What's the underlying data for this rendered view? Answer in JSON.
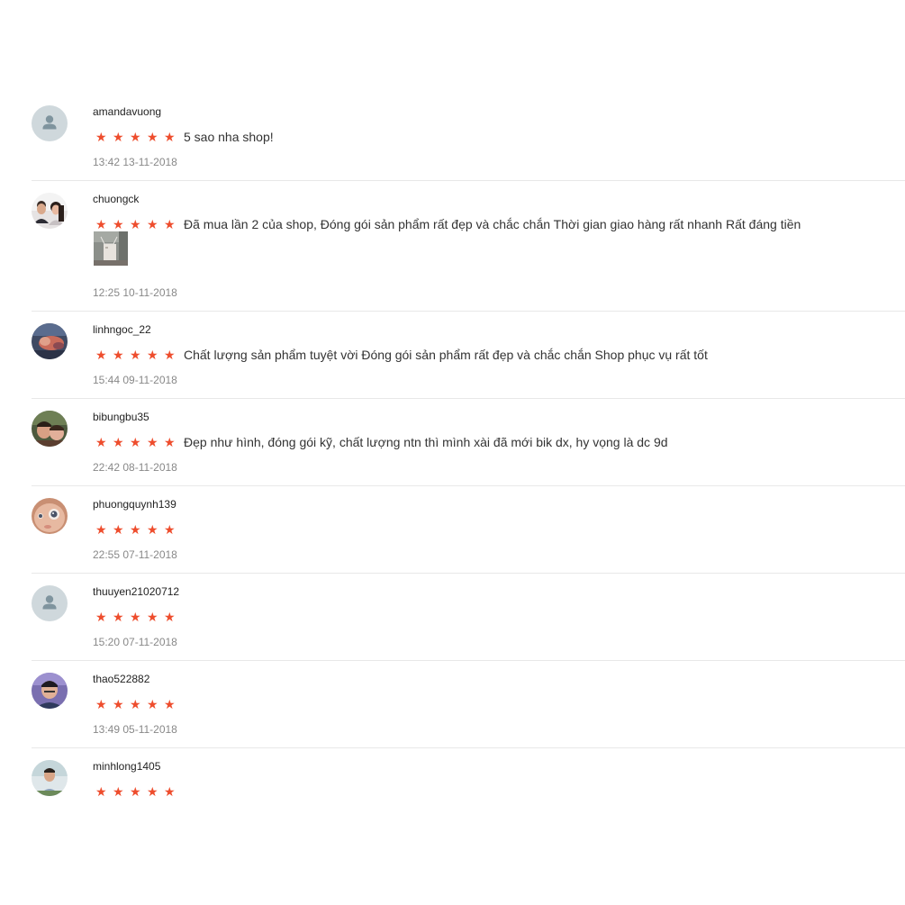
{
  "reviews": [
    {
      "username": "amandavuong",
      "stars": 5,
      "comment": "5 sao nha shop!",
      "time": "13:42 13-11-2018",
      "avatar": "default-avatar-icon",
      "has_photo": false
    },
    {
      "username": "chuongck",
      "stars": 5,
      "comment": "Đã mua lần 2 của shop,  Đóng gói sản phẩm rất đẹp và chắc chắn Thời gian giao hàng rất nhanh Rất đáng tiền",
      "time": "12:25 10-11-2018",
      "avatar": "user-photo",
      "has_photo": true
    },
    {
      "username": "linhngoc_22",
      "stars": 5,
      "comment": "Chất lượng sản phẩm tuyệt vời Đóng gói sản phẩm rất đẹp và chắc chắn Shop phục vụ rất tốt",
      "time": "15:44 09-11-2018",
      "avatar": "user-photo",
      "has_photo": false
    },
    {
      "username": "bibungbu35",
      "stars": 5,
      "comment": "Đẹp như hình, đóng gói kỹ, chất lượng ntn thì mình xài đã mới bik dx, hy vọng là dc 9d",
      "time": "22:42 08-11-2018",
      "avatar": "user-photo",
      "has_photo": false
    },
    {
      "username": "phuongquynh139",
      "stars": 5,
      "comment": "",
      "time": "22:55 07-11-2018",
      "avatar": "user-photo",
      "has_photo": false
    },
    {
      "username": "thuuyen21020712",
      "stars": 5,
      "comment": "",
      "time": "15:20 07-11-2018",
      "avatar": "default-avatar-icon",
      "has_photo": false
    },
    {
      "username": "thao522882",
      "stars": 5,
      "comment": "",
      "time": "13:49 05-11-2018",
      "avatar": "user-photo",
      "has_photo": false
    },
    {
      "username": "minhlong1405",
      "stars": 5,
      "comment": "",
      "time": "",
      "avatar": "user-photo",
      "has_photo": false
    }
  ],
  "colors": {
    "star": "#ee4d2d",
    "username": "#222222",
    "comment": "#333333",
    "time": "#888888",
    "divider": "#e8e8e8"
  }
}
